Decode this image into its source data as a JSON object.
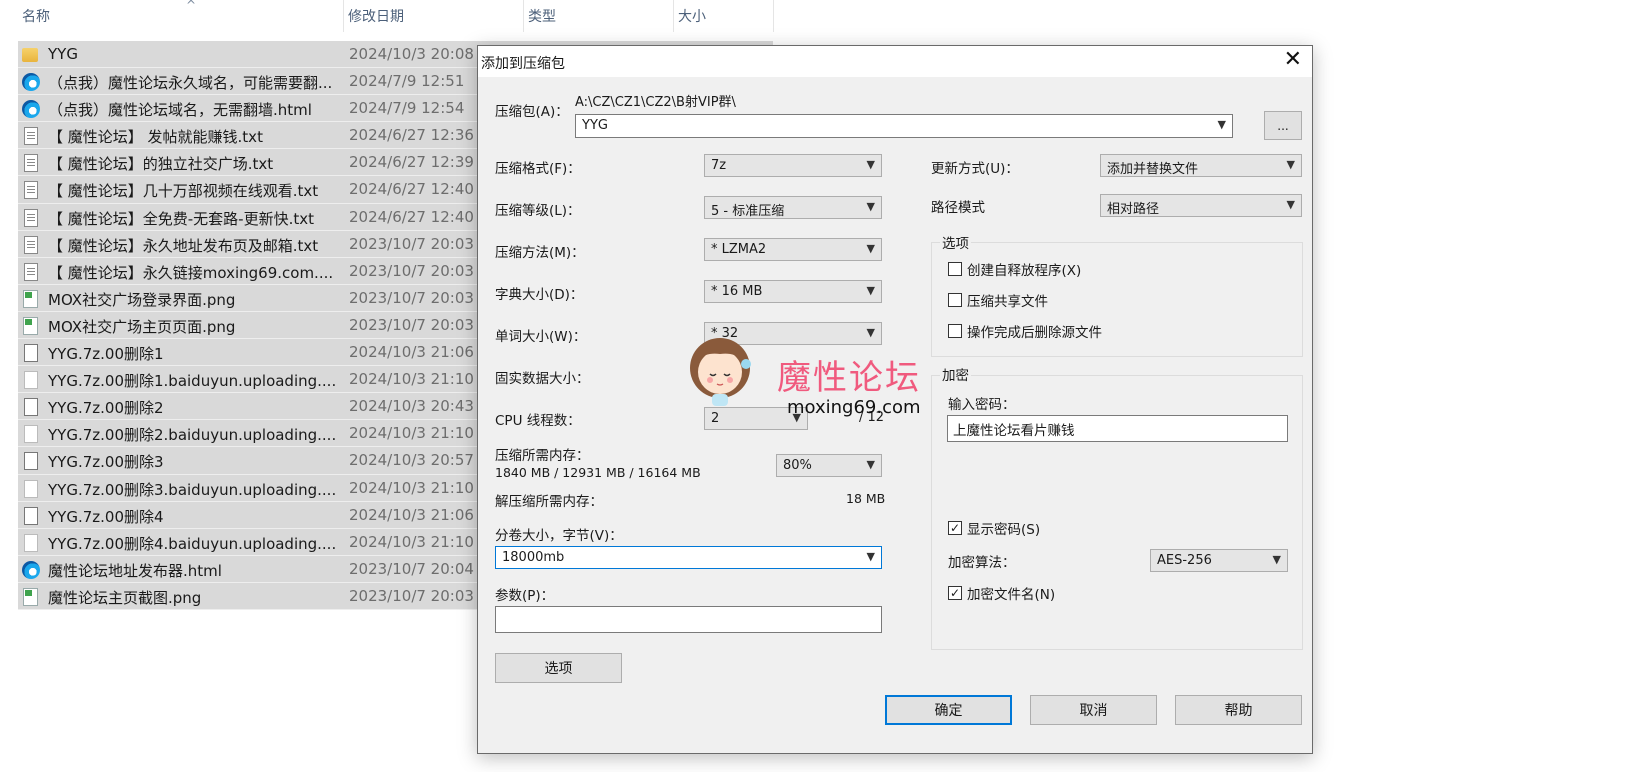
{
  "explorer": {
    "columns": [
      "名称",
      "修改日期",
      "类型",
      "大小"
    ],
    "sort_indicator": "^",
    "files": [
      {
        "name": "YYG",
        "date": "2024/10/3 20:08",
        "icon": "folder-icon"
      },
      {
        "name": "（点我）魔性论坛永久域名，可能需要翻...",
        "date": "2024/7/9 12:51",
        "icon": "edge-icon"
      },
      {
        "name": "（点我）魔性论坛域名，无需翻墙.html",
        "date": "2024/7/9 12:54",
        "icon": "edge-icon"
      },
      {
        "name": "【 魔性论坛】 发帖就能赚钱.txt",
        "date": "2024/6/27 12:36",
        "icon": "text-file-icon"
      },
      {
        "name": "【 魔性论坛】的独立社交广场.txt",
        "date": "2024/6/27 12:39",
        "icon": "text-file-icon"
      },
      {
        "name": "【 魔性论坛】几十万部视频在线观看.txt",
        "date": "2024/6/27 12:40",
        "icon": "text-file-icon"
      },
      {
        "name": "【 魔性论坛】全免费-无套路-更新快.txt",
        "date": "2024/6/27 12:40",
        "icon": "text-file-icon"
      },
      {
        "name": "【 魔性论坛】永久地址发布页及邮箱.txt",
        "date": "2023/10/7 20:03",
        "icon": "text-file-icon"
      },
      {
        "name": "【 魔性论坛】永久链接moxing69.com....",
        "date": "2023/10/7 20:03",
        "icon": "text-file-icon"
      },
      {
        "name": "MOX社交广场登录界面.png",
        "date": "2023/10/7 20:03",
        "icon": "image-file-icon"
      },
      {
        "name": "MOX社交广场主页页面.png",
        "date": "2023/10/7 20:03",
        "icon": "image-file-icon"
      },
      {
        "name": "YYG.7z.00删除1",
        "date": "2024/10/3 21:06",
        "icon": "blank-file-icon"
      },
      {
        "name": "YYG.7z.00删除1.baiduyun.uploading....",
        "date": "2024/10/3 21:10",
        "icon": "blank-file-icon"
      },
      {
        "name": "YYG.7z.00删除2",
        "date": "2024/10/3 20:43",
        "icon": "blank-file-icon"
      },
      {
        "name": "YYG.7z.00删除2.baiduyun.uploading....",
        "date": "2024/10/3 21:10",
        "icon": "blank-file-icon"
      },
      {
        "name": "YYG.7z.00删除3",
        "date": "2024/10/3 20:57",
        "icon": "blank-file-icon"
      },
      {
        "name": "YYG.7z.00删除3.baiduyun.uploading....",
        "date": "2024/10/3 21:10",
        "icon": "blank-file-icon"
      },
      {
        "name": "YYG.7z.00删除4",
        "date": "2024/10/3 21:06",
        "icon": "blank-file-icon"
      },
      {
        "name": "YYG.7z.00删除4.baiduyun.uploading....",
        "date": "2024/10/3 21:10",
        "icon": "blank-file-icon"
      },
      {
        "name": "魔性论坛地址发布器.html",
        "date": "2023/10/7 20:04",
        "icon": "edge-icon"
      },
      {
        "name": "魔性论坛主页截图.png",
        "date": "2023/10/7 20:03",
        "icon": "image-file-icon"
      }
    ]
  },
  "dialog": {
    "title": "添加到压缩包",
    "close": "✕",
    "archive_label": "压缩包(A)：",
    "archive_path": "A:\\CZ\\CZ1\\CZ2\\B射VIP群\\",
    "archive_name": "YYG",
    "browse_label": "...",
    "format_label": "压缩格式(F)：",
    "format_value": "7z",
    "level_label": "压缩等级(L)：",
    "level_value": "5 - 标准压缩",
    "method_label": "压缩方法(M)：",
    "method_value": "* LZMA2",
    "dict_label": "字典大小(D)：",
    "dict_value": "* 16 MB",
    "word_label": "单词大小(W)：",
    "word_value": "* 32",
    "solid_label": "固实数据大小：",
    "cpu_label": "CPU 线程数：",
    "cpu_value": "2",
    "cpu_total": "/ 12",
    "mem_label": "压缩所需内存：",
    "mem_value": "1840 MB / 12931 MB / 16164 MB",
    "mem_percent": "80%",
    "decomp_label": "解压缩所需内存：",
    "decomp_value": "18 MB",
    "split_label": "分卷大小，字节(V)：",
    "split_value": "18000mb",
    "params_label": "参数(P)：",
    "params_value": "",
    "options_button": "选项",
    "update_label": "更新方式(U)：",
    "update_value": "添加并替换文件",
    "path_label": "路径模式",
    "path_value": "相对路径",
    "options_group": "选项",
    "opt_sfx": "创建自释放程序(X)",
    "opt_shared": "压缩共享文件",
    "opt_delete": "操作完成后删除源文件",
    "encrypt_group": "加密",
    "password_label": "输入密码：",
    "password_value": "上魔性论坛看片赚钱",
    "show_password": "显示密码(S)",
    "enc_method_label": "加密算法：",
    "enc_method_value": "AES-256",
    "encrypt_names": "加密文件名(N)",
    "ok": "确定",
    "cancel": "取消",
    "help": "帮助"
  },
  "watermark": {
    "text": "魔性论坛",
    "url": "moxing69.com"
  }
}
